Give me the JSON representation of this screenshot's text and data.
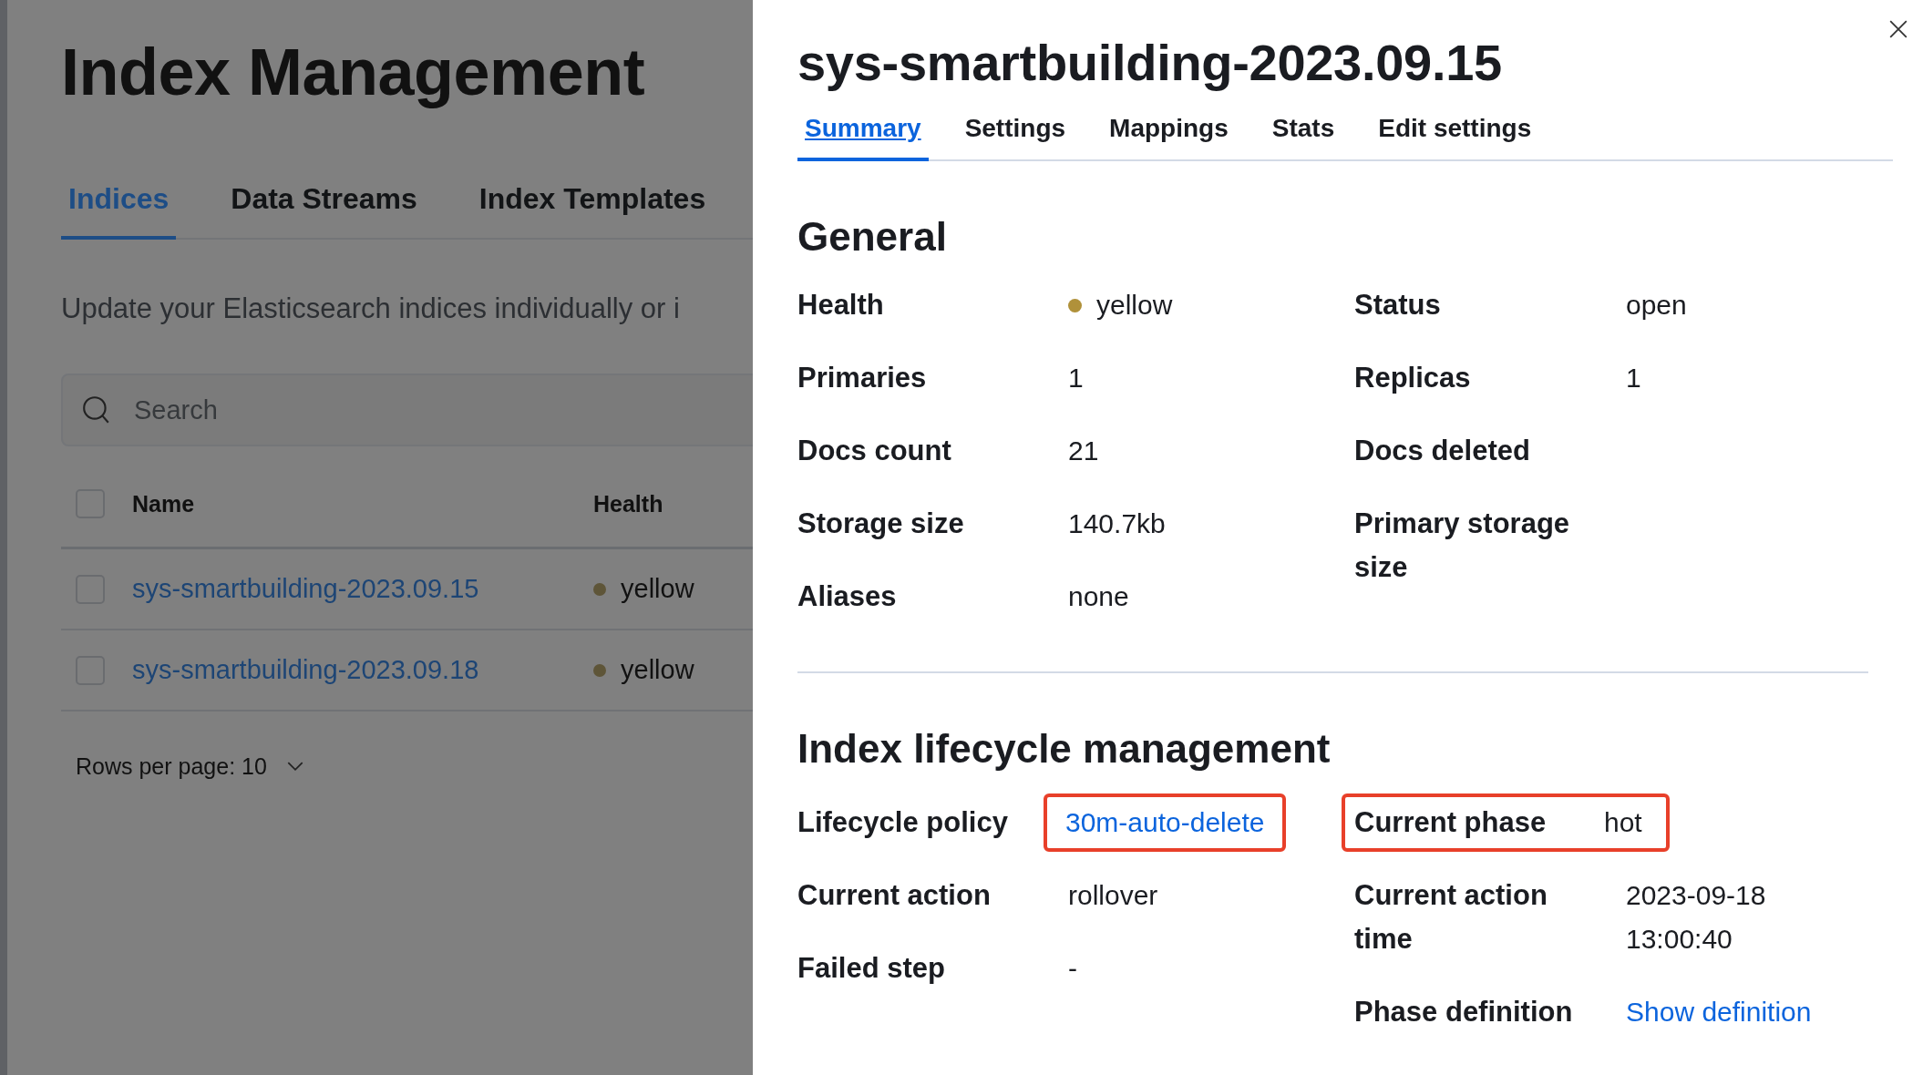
{
  "page": {
    "title": "Index Management",
    "tabs": [
      {
        "label": "Indices",
        "selected": true
      },
      {
        "label": "Data Streams",
        "selected": false
      },
      {
        "label": "Index Templates",
        "selected": false
      }
    ],
    "description": "Update your Elasticsearch indices individually or i",
    "search": {
      "placeholder": "Search"
    },
    "table": {
      "columns": [
        "Name",
        "Health"
      ],
      "select_all_checked": false,
      "rows": [
        {
          "name": "sys-smartbuilding-2023.09.15",
          "health": "yellow",
          "color": "#5e5538",
          "checked": false
        },
        {
          "name": "sys-smartbuilding-2023.09.18",
          "health": "yellow",
          "color": "#5e5538",
          "checked": false
        }
      ]
    },
    "pagination": {
      "rows_per_page": "Rows per page: 10"
    }
  },
  "flyout": {
    "title": "sys-smartbuilding-2023.09.15",
    "tabs": [
      {
        "label": "Summary",
        "selected": true
      },
      {
        "label": "Settings",
        "selected": false
      },
      {
        "label": "Mappings",
        "selected": false
      },
      {
        "label": "Stats",
        "selected": false
      },
      {
        "label": "Edit settings",
        "selected": false
      }
    ],
    "sections": [
      {
        "heading": "General",
        "left": [
          {
            "label": "Health",
            "value": "yellow",
            "kind": "status",
            "color": "#b0913a"
          },
          {
            "label": "Primaries",
            "value": "1",
            "kind": "text"
          },
          {
            "label": "Docs count",
            "value": "21",
            "kind": "text"
          },
          {
            "label": "Storage size",
            "value": "140.7kb",
            "kind": "text"
          },
          {
            "label": "Aliases",
            "value": "none",
            "kind": "text"
          }
        ],
        "right": [
          {
            "label": "Status",
            "value": "open",
            "kind": "text"
          },
          {
            "label": "Replicas",
            "value": "1",
            "kind": "text"
          },
          {
            "label": "Docs deleted"
          },
          {
            "label": "Primary storage size"
          }
        ]
      },
      {
        "heading": "Index lifecycle management",
        "left": [
          {
            "label": "Lifecycle policy",
            "value": "30m-auto-delete",
            "kind": "link",
            "highlighted": true
          },
          {
            "label": "Current action",
            "value": "rollover",
            "kind": "text"
          },
          {
            "label": "Failed step",
            "value": "-",
            "kind": "text"
          }
        ],
        "right": [
          {
            "label": "Current phase",
            "value": "hot",
            "kind": "text",
            "highlighted": true
          },
          {
            "label": "Current action time",
            "value": "2023-09-18 13:00:40",
            "kind": "text"
          },
          {
            "label": "Phase definition",
            "value": "Show definition",
            "kind": "link"
          }
        ]
      }
    ]
  }
}
